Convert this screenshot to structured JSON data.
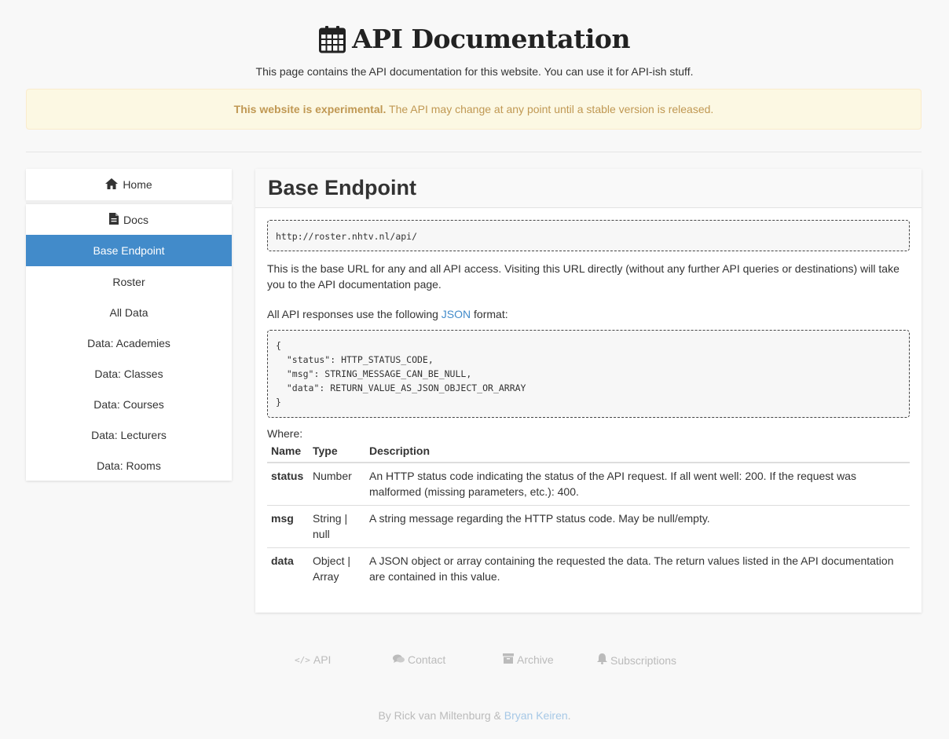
{
  "header": {
    "title": "API Documentation",
    "subtitle": "This page contains the API documentation for this website. You can use it for API-ish stuff."
  },
  "alert": {
    "strong": "This website is experimental.",
    "text": " The API may change at any point until a stable version is released."
  },
  "sidebar": {
    "home_label": "Home",
    "docs_label": "Docs",
    "items": [
      {
        "label": "Base Endpoint",
        "active": true
      },
      {
        "label": "Roster"
      },
      {
        "label": "All Data"
      },
      {
        "label": "Data: Academies"
      },
      {
        "label": "Data: Classes"
      },
      {
        "label": "Data: Courses"
      },
      {
        "label": "Data: Lecturers"
      },
      {
        "label": "Data: Rooms"
      }
    ]
  },
  "main": {
    "title": "Base Endpoint",
    "url": "http://roster.nhtv.nl/api/",
    "para1": "This is the base URL for any and all API access. Visiting this URL directly (without any further API queries or destinations) will take you to the API documentation page.",
    "para2_prefix": "All API responses use the following ",
    "para2_link": "JSON",
    "para2_suffix": " format:",
    "json_sample": "{\n  \"status\": HTTP_STATUS_CODE,\n  \"msg\": STRING_MESSAGE_CAN_BE_NULL,\n  \"data\": RETURN_VALUE_AS_JSON_OBJECT_OR_ARRAY\n}",
    "where": "Where:",
    "table": {
      "headers": [
        "Name",
        "Type",
        "Description"
      ],
      "rows": [
        {
          "name": "status",
          "type": "Number",
          "desc": "An HTTP status code indicating the status of the API request. If all went well: 200. If the request was malformed (missing parameters, etc.): 400."
        },
        {
          "name": "msg",
          "type": "String | null",
          "desc": "A string message regarding the HTTP status code. May be null/empty."
        },
        {
          "name": "data",
          "type": "Object | Array",
          "desc": "A JSON object or array containing the requested the data. The return values listed in the API documentation are contained in this value."
        }
      ]
    }
  },
  "footer": {
    "links": [
      {
        "icon": "code-icon",
        "label": "API"
      },
      {
        "icon": "comments-icon",
        "label": "Contact"
      },
      {
        "icon": "archive-icon",
        "label": "Archive"
      },
      {
        "icon": "bell-icon",
        "label": "Subscriptions"
      }
    ],
    "credit_prefix": "By Rick van Miltenburg & ",
    "credit_link": "Bryan Keiren",
    "credit_suffix": "."
  },
  "colors": {
    "accent": "#428bca",
    "alert_bg": "#fcf8e3",
    "alert_text": "#c09853",
    "footer_text": "#bbbbbb"
  }
}
